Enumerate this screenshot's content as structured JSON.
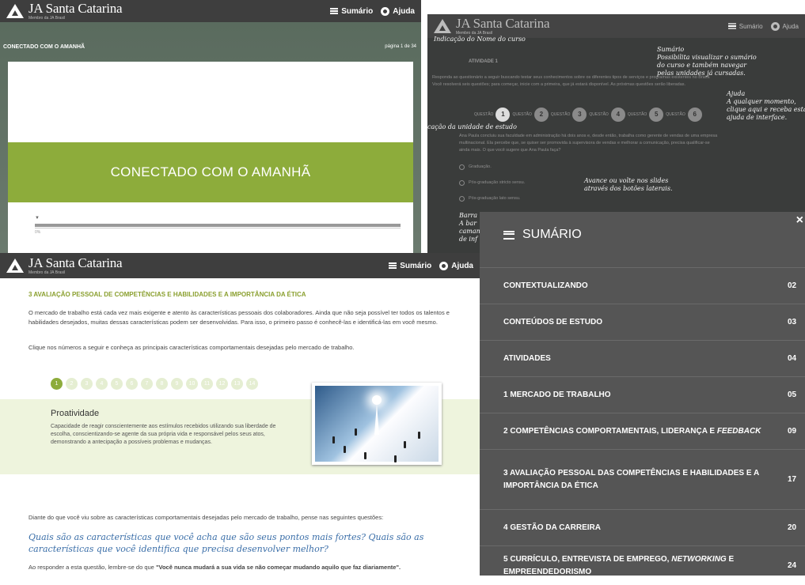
{
  "brand": {
    "name": "JA Santa Catarina",
    "sub": "Membro da JA Brasil"
  },
  "toolbar": {
    "summary": "Sumário",
    "help": "Ajuda"
  },
  "win1": {
    "crumb": "CONECTADO COM O AMANHÃ",
    "page": "página 1 de 34",
    "banner": "CONECTADO COM O AMANHÃ",
    "pct": "0%"
  },
  "win2": {
    "atividade": "ATIVIDADE 1",
    "intro1": "Responda ao questionário a seguir buscando testar seus conhecimentos sobre os diferentes tipos de serviços e programas existentes no Brasil.",
    "intro2": "Você resolverá seis questões; para começar, inicie com a primeira, que já estará disponível. As próximas questões serão liberadas.",
    "q_label": "QUESTÃO",
    "questions": [
      "1",
      "2",
      "3",
      "4",
      "5",
      "6"
    ],
    "case1": "Ana Paula concluiu sua faculdade em administração há dois anos e, desde então, trabalha como gerente de vendas de uma empresa",
    "case2": "multinacional. Ela percebe que, se quiser ser promovida à supervisora de vendas e melhorar a comunicação, precisa qualificar-se",
    "case3": "ainda mais. O que você sugere que Ana Paula faça?",
    "options": [
      "Graduação.",
      "Pós-graduação stricto sensu.",
      "Pós-graduação lato sensu."
    ],
    "notes": {
      "course": "Indicação do Nome do curso",
      "sumario": "Sumário\nPossibilita visualizar o sumário\ndo curso e também navegar\npelas unidades já cursadas.",
      "ajuda": "Ajuda\nA qualquer momento,\nclique aqui e receba esta\najuda de interface.",
      "unidade": "cação da unidade de estudo",
      "avance": "Avance ou volte nos slides\natravés dos botões laterais.",
      "barra": "Barra\nA bar\ncaman\nde inf"
    }
  },
  "win3": {
    "title": "3 AVALIAÇÃO PESSOAL DE COMPETÊNCIAS E HABILIDADES E A IMPORTÂNCIA DA ÉTICA",
    "p1": "O mercado de trabalho está cada vez mais exigente e atento às características pessoais dos colaboradores. Ainda que não seja possível ter todos os talentos e habilidades desejados, muitas dessas características podem ser desenvolvidas. Para isso, o primeiro passo é conhecê-las e identificá-las em você mesmo.",
    "p2": "Clique nos números a seguir e conheça as principais características comportamentais desejadas pelo mercado de trabalho.",
    "bullets": [
      "1",
      "2",
      "3",
      "4",
      "5",
      "6",
      "7",
      "8",
      "9",
      "10",
      "11",
      "12",
      "13",
      "14"
    ],
    "panel_title": "Proatividade",
    "panel_text": "Capacidade de reagir conscientemente aos estímulos recebidos utilizando sua liberdade de escolha, conscientizando-se agente da sua própria vida e responsável pelos seus atos, demonstrando a antecipação a possíveis problemas e mudanças.",
    "p3": "Diante do que você viu sobre as características comportamentais desejadas pelo mercado de trabalho, pense nas seguintes questões:",
    "quote": "Quais são as características que você acha que são seus pontos mais fortes? Quais são as características que você identifica que precisa desenvolver melhor?",
    "p4a": "Ao responder a esta questão, lembre-se do que ",
    "p4b": "\"Você nunca mudará a sua vida se não começar mudando aquilo que faz diariamente\"."
  },
  "summary": {
    "title": "SUMÁRIO",
    "close": "×",
    "items": [
      {
        "label": "CONTEXTUALIZANDO",
        "page": "02"
      },
      {
        "label": "CONTEÚDOS DE ESTUDO",
        "page": "03"
      },
      {
        "label": "ATIVIDADES",
        "page": "04"
      },
      {
        "label": "1 MERCADO DE TRABALHO",
        "page": "05"
      },
      {
        "label": "2 COMPETÊNCIAS COMPORTAMENTAIS, LIDERANÇA E ",
        "em": "FEEDBACK",
        "page": "09"
      },
      {
        "label": "3 AVALIAÇÃO PESSOAL DAS COMPETÊNCIAS E HABILIDADES E A IMPORTÂNCIA DA ÉTICA",
        "page": "17"
      },
      {
        "label": "4 GESTÃO DA CARREIRA",
        "page": "20"
      },
      {
        "label": "5 CURRÍCULO, ENTREVISTA DE EMPREGO, ",
        "em": "NETWORKING",
        "label2": " E EMPREENDEDORISMO",
        "page": "24"
      }
    ]
  }
}
